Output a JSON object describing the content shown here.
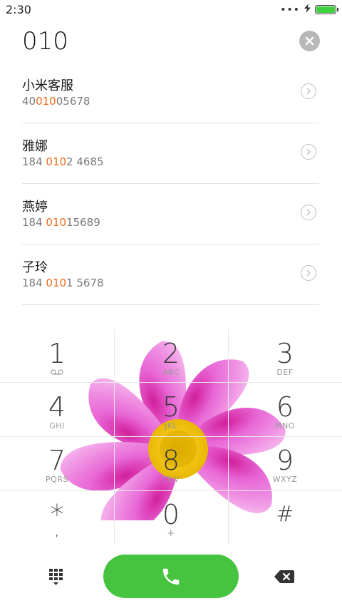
{
  "status_bar": {
    "time": "2:30",
    "signal_dots": "•••",
    "battery_level": 1.0
  },
  "dial": {
    "number": "010"
  },
  "results": [
    {
      "name": "小米客服",
      "number_pre": "40",
      "number_match": "010",
      "number_post": "05678"
    },
    {
      "name": "雅娜",
      "number_pre": "184 ",
      "number_match": "010",
      "number_post": "2 4685"
    },
    {
      "name": "燕婷",
      "number_pre": "184 ",
      "number_match": "010",
      "number_post": "15689"
    },
    {
      "name": "子玲",
      "number_pre": "184 ",
      "number_match": "010",
      "number_post": "1 5678"
    }
  ],
  "keypad": [
    {
      "digit": "1",
      "letters": ""
    },
    {
      "digit": "2",
      "letters": "ABC"
    },
    {
      "digit": "3",
      "letters": "DEF"
    },
    {
      "digit": "4",
      "letters": "GHI"
    },
    {
      "digit": "5",
      "letters": "JKL"
    },
    {
      "digit": "6",
      "letters": "MNO"
    },
    {
      "digit": "7",
      "letters": "PQRS"
    },
    {
      "digit": "8",
      "letters": "TUV"
    },
    {
      "digit": "9",
      "letters": "WXYZ"
    },
    {
      "digit": "*",
      "letters": ","
    },
    {
      "digit": "0",
      "letters": "+"
    },
    {
      "digit": "#",
      "letters": ""
    }
  ],
  "colors": {
    "accent_green": "#46c33f",
    "highlight_orange": "#f26a1b",
    "battery_green": "#3fcf3f"
  },
  "icons": {
    "voicemail": "voicemail-icon",
    "clear": "clear-icon",
    "detail": "chevron-right-icon",
    "call": "phone-icon",
    "dialpad": "dialpad-icon",
    "backspace": "backspace-icon"
  }
}
